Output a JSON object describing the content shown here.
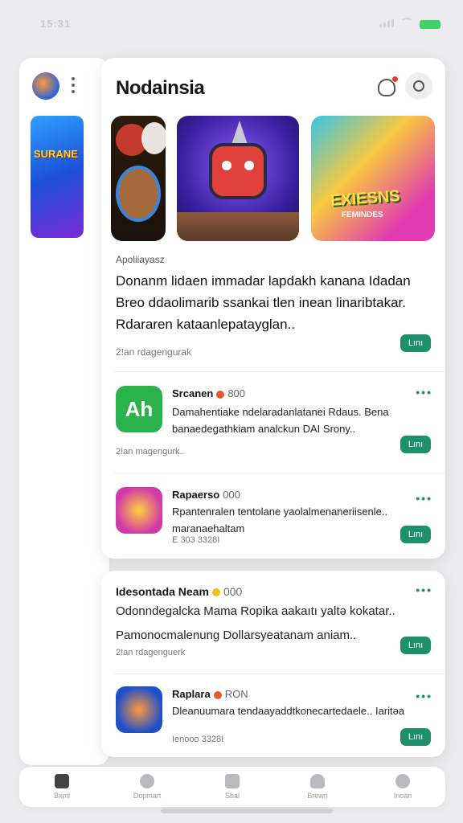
{
  "status_bar": {
    "time": "15:31"
  },
  "app": {
    "title": "Nodainsia"
  },
  "banners": [
    {
      "art_text": ""
    },
    {
      "art_text": ""
    },
    {
      "art_text": "EXIESNS",
      "art_sub": "FEMINDES"
    }
  ],
  "featured": {
    "category": "Apoliiayasz",
    "description": "Donanm lidaen immadar lapdakh kanana Idadan Breo ddaolimarib ssankai tlen inean linaribtakar. Rdararen kataanlepatayglan..",
    "meta": "2!an rdagengurak",
    "get_label": "Lını"
  },
  "apps": [
    {
      "name": "Srcanen",
      "rating": "800",
      "description": "Damahentiake ndelaradanlatanei Rdaus. Bena banaedegathkiam analckun DAI Srony..",
      "meta": "2!an magengurk..",
      "get_label": "Lını",
      "more": "•••",
      "icon_text": "Ah"
    },
    {
      "name": "Rapaerso",
      "rating": "000",
      "description": "Rpantenralen tentolane yaolalmenaneriisenle.. maranaehaltam",
      "meta": "E 303 3328I",
      "get_label": "Lını",
      "more": "•••"
    }
  ],
  "second_apps": [
    {
      "name": "Idesontada Neam",
      "rating": "000",
      "description": "Odonndegalcka Mama Ropika aakaıtı yaltə kokatar.. Pamonocmalenung Dollarsyeatanam aniam..",
      "meta": "2!an rdagenguerk",
      "get_label": "Lını",
      "more": "•••"
    },
    {
      "name": "Raplara",
      "rating": "RON",
      "description": "Dleanuumara tendaayaddtkonecartedaele.. Iaritəa",
      "meta": "Ienooo 3328I",
      "get_label": "Lını",
      "more": "•••"
    }
  ],
  "tabs": [
    {
      "label": "Bxml"
    },
    {
      "label": "Dopmart"
    },
    {
      "label": "Sbal"
    },
    {
      "label": "Brewri"
    },
    {
      "label": "Inoari"
    }
  ],
  "colors": {
    "accent": "#1f8f6b",
    "notification": "#e33333",
    "battery": "#41d16a"
  }
}
